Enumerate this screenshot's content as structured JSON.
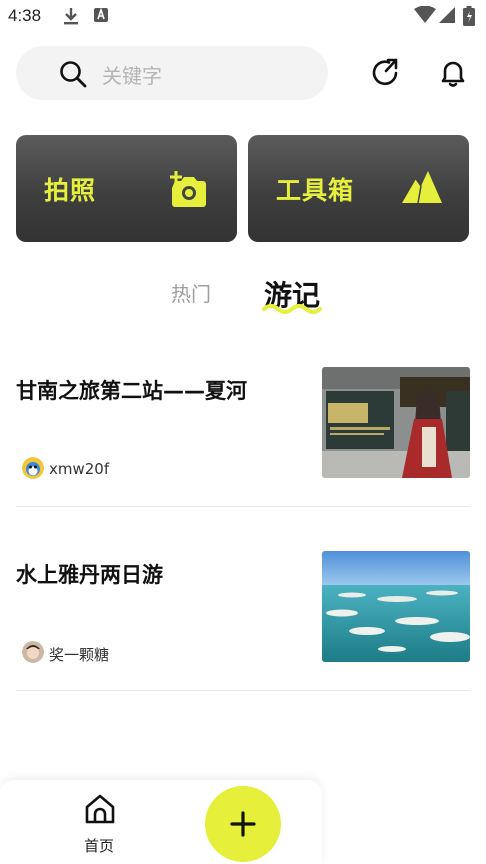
{
  "status_bar": {
    "time": "4:38",
    "icons": [
      "download-icon",
      "notification-a-icon",
      "wifi-icon",
      "signal-icon",
      "battery-icon"
    ]
  },
  "header": {
    "search_placeholder": "关键字",
    "icons": [
      "refresh-share-icon",
      "bell-icon"
    ]
  },
  "tools": [
    {
      "label": "拍照",
      "icon": "camera-plus-icon"
    },
    {
      "label": "工具箱",
      "icon": "mountain-icon"
    }
  ],
  "tabs": [
    {
      "label": "热门",
      "active": false
    },
    {
      "label": "游记",
      "active": true
    }
  ],
  "articles": [
    {
      "title": "甘南之旅第二站——夏河",
      "author": "xmw20f",
      "thumbnail": "temple-photo"
    },
    {
      "title": "水上雅丹两日游",
      "author": "奖一颗糖",
      "thumbnail": "lake-photo"
    }
  ],
  "bottom_nav": {
    "home_label": "首页",
    "fab_icon": "plus-icon"
  },
  "colors": {
    "accent": "#e6ef3a",
    "card_dark": "#444444",
    "accent_text": "#e5ef3c"
  }
}
